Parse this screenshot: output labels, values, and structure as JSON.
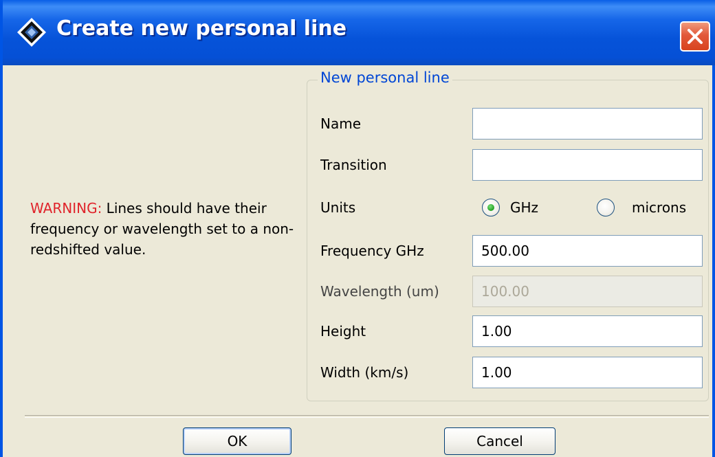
{
  "window": {
    "title": "Create new personal line"
  },
  "warning": {
    "label": "WARNING:",
    "text": " Lines should have their frequency or wavelength set to a non-redshifted value."
  },
  "form": {
    "group_title": "New personal line",
    "name_label": "Name",
    "name_value": "",
    "transition_label": "Transition",
    "transition_value": "",
    "units_label": "Units",
    "units_options": [
      "GHz",
      "microns"
    ],
    "units_selected": "GHz",
    "frequency_label": "Frequency GHz",
    "frequency_value": "500.00",
    "wavelength_label": "Wavelength (um)",
    "wavelength_value": "100.00",
    "height_label": "Height",
    "height_value": "1.00",
    "width_label": "Width (km/s)",
    "width_value": "1.00"
  },
  "buttons": {
    "ok": "OK",
    "cancel": "Cancel"
  },
  "icons": {
    "app": "app-diamond-icon",
    "close": "close-icon"
  },
  "colors": {
    "titlebar": "#0653D9",
    "warning_label": "#E0242B",
    "group_title": "#0046D5",
    "close_button": "#E2593A",
    "radio_selected": "#21A121"
  }
}
